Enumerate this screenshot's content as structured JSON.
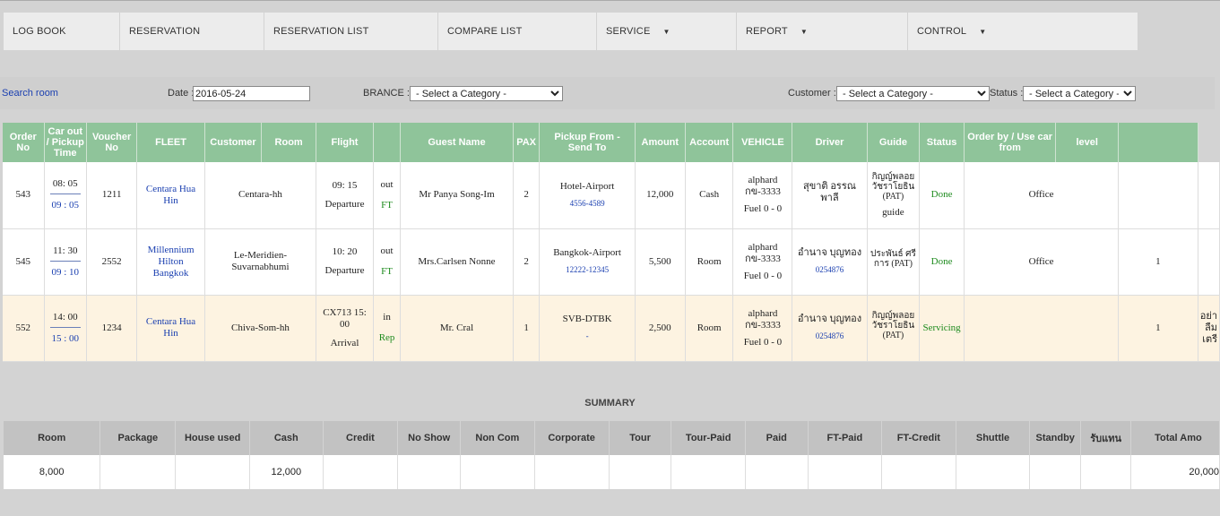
{
  "nav": [
    {
      "label": "LOG BOOK",
      "dropdown": false
    },
    {
      "label": "RESERVATION",
      "dropdown": false
    },
    {
      "label": "RESERVATION LIST",
      "dropdown": false
    },
    {
      "label": "COMPARE LIST",
      "dropdown": false
    },
    {
      "label": "SERVICE",
      "dropdown": true
    },
    {
      "label": "REPORT",
      "dropdown": true
    },
    {
      "label": "CONTROL",
      "dropdown": true
    }
  ],
  "search": {
    "title": "Search room",
    "date_label": "Date :",
    "date_value": "2016-05-24",
    "branch_label": "BRANCE :",
    "branch_value": "- Select a Category -",
    "customer_label": "Customer :",
    "customer_value": "- Select a Category -",
    "status_label": "Status :",
    "status_value": "- Select a Category -"
  },
  "table": {
    "headers": {
      "order": "Order No",
      "carout": "Car out / Pickup Time",
      "voucher": "Voucher No",
      "fleet": "FLEET",
      "customer": "Customer",
      "room": "Room",
      "flight": "Flight",
      "guest": "Guest Name",
      "pax": "PAX",
      "pickup": "Pickup From - Send To",
      "amount": "Amount",
      "account": "Account",
      "vehicle": "VEHICLE",
      "driver": "Driver",
      "guide": "Guide",
      "status": "Status",
      "orderby": "Order by / Use car from",
      "level": "level"
    },
    "rows": [
      {
        "order": "543",
        "carout": "08: 05",
        "pickup": "09 : 05",
        "voucher": "1211",
        "fleet": "Centara Hua Hin",
        "customer": "Centara-hh",
        "flight": "09: 15",
        "flight_type": "Departure",
        "dir": "out",
        "code": "FT",
        "guest": "Mr Panya Song-Im",
        "pax": "2",
        "route": "Hotel-Airport",
        "route_phone": "4556-4589",
        "amount": "12,000",
        "account": "Cash",
        "vehicle": "alphard",
        "plate": "กข-3333",
        "fuel": "Fuel 0 - 0",
        "driver": "สุขาติ อรรณพาลี",
        "driver_phone": "",
        "guide": "กิญญ์พลอย วัชราโยธิน (PAT)",
        "guide_extra": "guide",
        "status": "Done",
        "orderby": "Office",
        "level": "",
        "note": ""
      },
      {
        "order": "545",
        "carout": "11: 30",
        "pickup": "09 : 10",
        "voucher": "2552",
        "fleet": "Millennium Hilton Bangkok",
        "customer": "Le-Meridien-Suvarnabhumi",
        "flight": "10: 20",
        "flight_type": "Departure",
        "dir": "out",
        "code": "FT",
        "guest": "Mrs.Carlsen Nonne",
        "pax": "2",
        "route": "Bangkok-Airport",
        "route_phone": "12222-12345",
        "amount": "5,500",
        "account": "Room",
        "vehicle": "alphard",
        "plate": "กข-3333",
        "fuel": "Fuel 0 - 0",
        "driver": "อำนาจ บุญทอง",
        "driver_phone": "0254876",
        "guide": "ประพันธ์ ศรีการ (PAT)",
        "guide_extra": "",
        "status": "Done",
        "orderby": "Office",
        "level": "1",
        "note": ""
      },
      {
        "order": "552",
        "carout": "14: 00",
        "pickup": "15 : 00",
        "voucher": "1234",
        "fleet": "Centara Hua Hin",
        "customer": "Chiva-Som-hh",
        "flight": "CX713 15: 00",
        "flight_type": "Arrival",
        "dir": "in",
        "code": "Rep",
        "guest": "Mr. Cral",
        "pax": "1",
        "route": "SVB-DTBK",
        "route_phone": "-",
        "amount": "2,500",
        "account": "Room",
        "vehicle": "alphard",
        "plate": "กข-3333",
        "fuel": "Fuel 0 - 0",
        "driver": "อำนาจ บุญทอง",
        "driver_phone": "0254876",
        "guide": "กิญญ์พลอย วัชราโยธิน (PAT)",
        "guide_extra": "",
        "status": "Servicing",
        "orderby": "",
        "level": "1",
        "note": "อย่าลืมเตรี"
      }
    ]
  },
  "summary": {
    "title": "SUMMARY",
    "headers": [
      "Room",
      "Package",
      "House used",
      "Cash",
      "Credit",
      "No Show",
      "Non Com",
      "Corporate",
      "Tour",
      "Tour-Paid",
      "Paid",
      "FT-Paid",
      "FT-Credit",
      "Shuttle",
      "Standby",
      "รับแทน",
      "Total Amo"
    ],
    "values": [
      "8,000",
      "",
      "",
      "12,000",
      "",
      "",
      "",
      "",
      "",
      "",
      "",
      "",
      "",
      "",
      "",
      "",
      "20,000"
    ]
  },
  "colors": {
    "header_green": "#8fc49a",
    "link_blue": "#1a3fb0",
    "status_green": "#1e8b1e",
    "highlight_row": "#fdf3e1"
  }
}
